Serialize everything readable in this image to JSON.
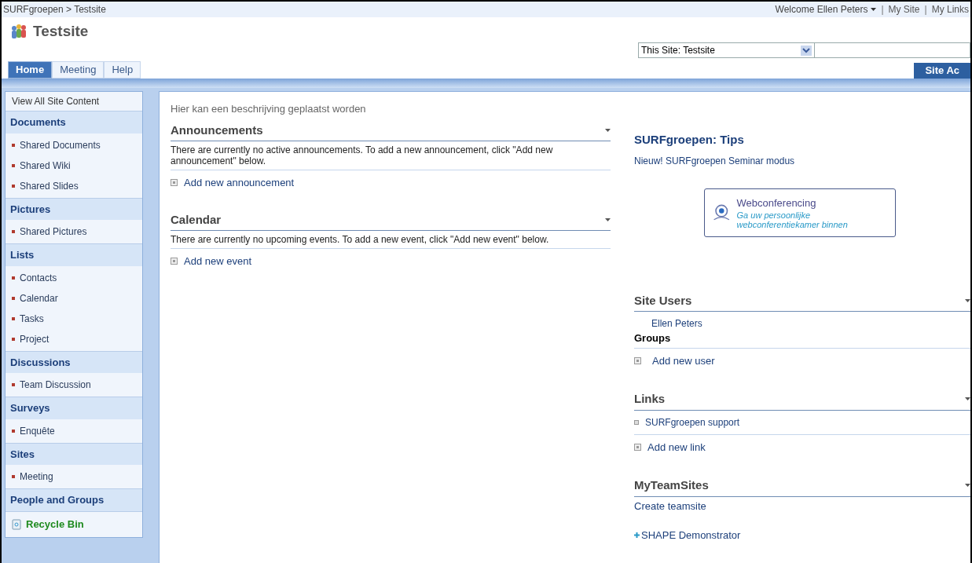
{
  "breadcrumb": "SURFgroepen > Testsite",
  "user_menu": {
    "welcome": "Welcome Ellen Peters",
    "separator": "|",
    "links": [
      "My Site",
      "My Links"
    ]
  },
  "site_title": "Testsite",
  "search": {
    "scope": "This Site: Testsite"
  },
  "tabs": [
    {
      "label": "Home",
      "selected": true
    },
    {
      "label": "Meeting",
      "selected": false
    },
    {
      "label": "Help",
      "selected": false
    }
  ],
  "site_actions": "Site Ac",
  "sidebar": {
    "view_all": "View All Site Content",
    "sections": [
      {
        "heading": "Documents",
        "items": [
          "Shared Documents",
          "Shared Wiki",
          "Shared Slides"
        ]
      },
      {
        "heading": "Pictures",
        "items": [
          "Shared Pictures"
        ]
      },
      {
        "heading": "Lists",
        "items": [
          "Contacts",
          "Calendar",
          "Tasks",
          "Project"
        ]
      },
      {
        "heading": "Discussions",
        "items": [
          "Team Discussion"
        ]
      },
      {
        "heading": "Surveys",
        "items": [
          "Enquête"
        ]
      },
      {
        "heading": "Sites",
        "items": [
          "Meeting"
        ]
      },
      {
        "heading": "People and Groups"
      }
    ],
    "recycle_bin": "Recycle Bin"
  },
  "description": "Hier kan een beschrijving geplaatst worden",
  "web_parts": [
    {
      "title": "Announcements",
      "message": "There are currently no active announcements. To add a new announcement, click \"Add new announcement\" below.",
      "add_link": "Add new announcement"
    },
    {
      "title": "Calendar",
      "message": "There are currently no upcoming events. To add a new event, click \"Add new event\" below.",
      "add_link": "Add new event"
    }
  ],
  "tips": {
    "title": "SURFgroepen: Tips",
    "link": "Nieuw! SURFgroepen Seminar modus"
  },
  "webconferencing": {
    "title": "Webconferencing",
    "subtitle": "Ga uw persoonlijke webconferentiekamer binnen"
  },
  "site_users": {
    "title": "Site Users",
    "users": [
      "Ellen Peters"
    ],
    "groups_heading": "Groups",
    "add_link": "Add new user"
  },
  "links": {
    "title": "Links",
    "items": [
      "SURFgroepen support"
    ],
    "add_link": "Add new link"
  },
  "my_team_sites": {
    "title": "MyTeamSites",
    "create": "Create teamsite",
    "sites": [
      "SHAPE Demonstrator"
    ]
  }
}
